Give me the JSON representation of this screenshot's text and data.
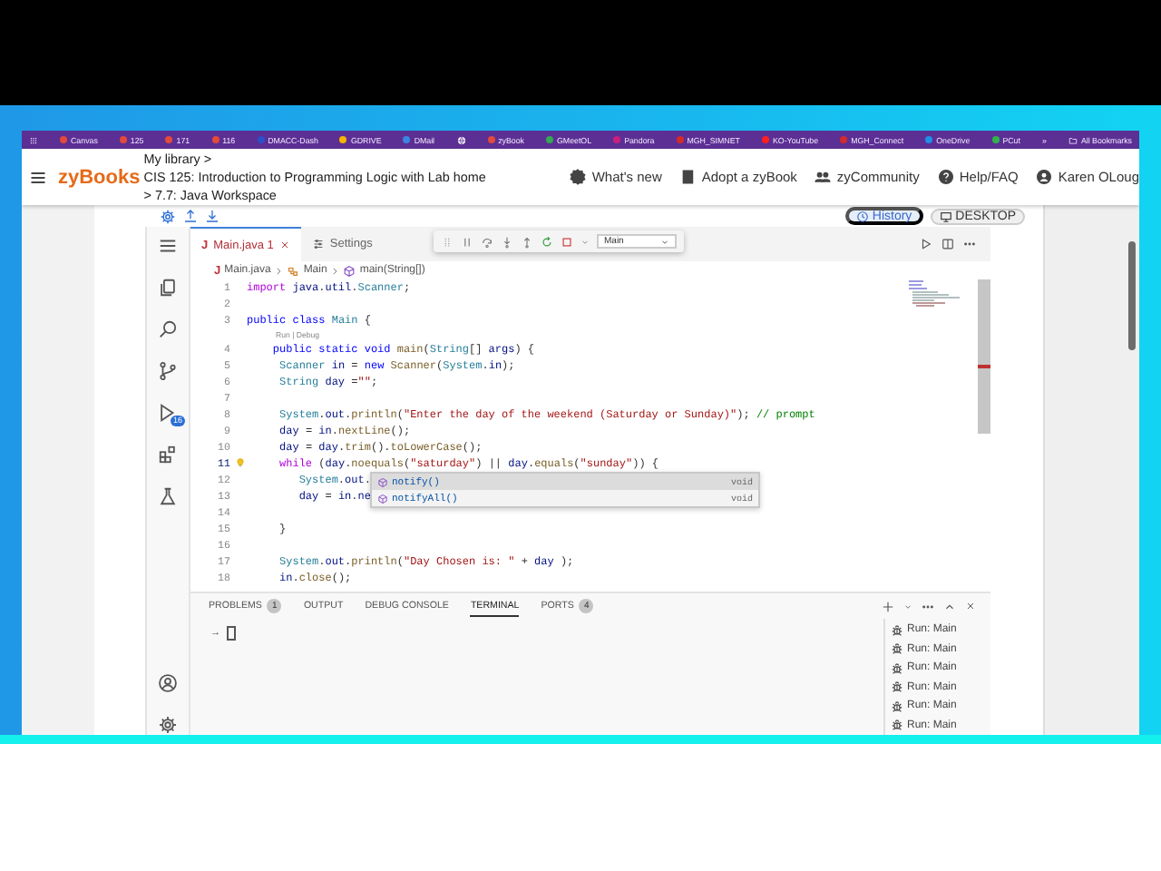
{
  "bookmarks_bar": {
    "items": [
      {
        "kind": "link",
        "label": "Canvas"
      },
      {
        "kind": "link",
        "label": "125"
      },
      {
        "kind": "link",
        "label": "171"
      },
      {
        "kind": "link",
        "label": "116"
      },
      {
        "kind": "link",
        "label": "DMACC-Dash"
      },
      {
        "kind": "link",
        "label": "GDRIVE"
      },
      {
        "kind": "link",
        "label": "DMail"
      },
      {
        "kind": "icon"
      },
      {
        "kind": "link",
        "label": "zyBook"
      },
      {
        "kind": "link",
        "label": "GMeetOL"
      },
      {
        "kind": "link",
        "label": "Pandora"
      },
      {
        "kind": "link",
        "label": "MGH_SIMNET"
      },
      {
        "kind": "link",
        "label": "KO-YouTube"
      },
      {
        "kind": "link",
        "label": "MGH_Connect"
      },
      {
        "kind": "link",
        "label": "OneDrive"
      },
      {
        "kind": "link",
        "label": "PCut"
      }
    ],
    "overflow": "»",
    "all_bookmarks": "All Bookmarks"
  },
  "header": {
    "logo": "zyBooks",
    "breadcrumb": [
      "My library >",
      "CIS 125: Introduction to Programming Logic with Lab home",
      "> 7.7: Java Workspace"
    ],
    "links": [
      "What's new",
      "Adopt a zyBook",
      "zyCommunity",
      "Help/FAQ",
      "Karen OLoug"
    ]
  },
  "workspace": {
    "history": "History",
    "desktop": "DESKTOP"
  },
  "ide": {
    "activity_badge": "16",
    "tabs": [
      {
        "icon": "J",
        "label": "Main.java",
        "problems": "1",
        "selected": true
      },
      {
        "label": "Settings",
        "selected": false
      }
    ],
    "run_config": "Main",
    "breadcrumb": [
      {
        "icon": "J",
        "label": "Main.java"
      },
      {
        "label": "Main"
      },
      {
        "label": "main(String[])"
      }
    ],
    "editor": {
      "lines": [
        {
          "number": "1",
          "text": "import java.util.Scanner;",
          "current": false,
          "lightbulb": false
        },
        {
          "number": "2",
          "current": false,
          "lightbulb": false
        },
        {
          "number": "3",
          "text": "public class Main {",
          "current": false,
          "lightbulb": false
        },
        {
          "number": "4",
          "codelens": "Run | Debug",
          "text": "    public static void main(String[] args) {",
          "current": false,
          "lightbulb": false
        },
        {
          "number": "5",
          "text": "     Scanner in = new Scanner(System.in);",
          "current": false,
          "lightbulb": false
        },
        {
          "number": "6",
          "text": "     String day =\"\";",
          "current": false,
          "lightbulb": false
        },
        {
          "number": "7",
          "current": false,
          "lightbulb": false
        },
        {
          "number": "8",
          "text": "     System.out.println(\"Enter the day of the weekend (Saturday or Sunday)\"); // prompt",
          "current": false,
          "lightbulb": false
        },
        {
          "number": "9",
          "text": "     day = in.nextLine();",
          "current": false,
          "lightbulb": false
        },
        {
          "number": "10",
          "text": "     day = day.trim().toLowerCase();",
          "current": false,
          "lightbulb": false
        },
        {
          "number": "11",
          "text": "     while (day.noequals(\"saturday\") || day.equals(\"sunday\")) {",
          "current": true,
          "lightbulb": true
        },
        {
          "number": "12",
          "text": "        System.out.",
          "current": false,
          "lightbulb": false
        },
        {
          "number": "13",
          "text": "        day = in.ne",
          "current": false,
          "lightbulb": false
        },
        {
          "number": "14",
          "current": false,
          "lightbulb": false
        },
        {
          "number": "15",
          "text": "     }",
          "current": false,
          "lightbulb": false
        },
        {
          "number": "16",
          "current": false,
          "lightbulb": false
        },
        {
          "number": "17",
          "text": "     System.out.println(\"Day Chosen is: \" + day );",
          "current": false,
          "lightbulb": false
        },
        {
          "number": "18",
          "text": "     in.close();",
          "current": false,
          "lightbulb": false
        }
      ],
      "suggestions": [
        {
          "label": "notify()",
          "type": "void",
          "selected": true
        },
        {
          "label": "notifyAll()",
          "type": "void",
          "selected": false
        }
      ]
    },
    "panel": {
      "tabs": [
        {
          "label": "PROBLEMS",
          "count": "1",
          "selected": false
        },
        {
          "label": "OUTPUT",
          "selected": false
        },
        {
          "label": "DEBUG CONSOLE",
          "selected": false
        },
        {
          "label": "TERMINAL",
          "selected": true
        },
        {
          "label": "PORTS",
          "count": "4",
          "selected": false
        }
      ],
      "prompt": "→",
      "terminals": [
        "Run: Main",
        "Run: Main",
        "Run: Main",
        "Run: Main",
        "Run: Main",
        "Run: Main"
      ]
    }
  }
}
